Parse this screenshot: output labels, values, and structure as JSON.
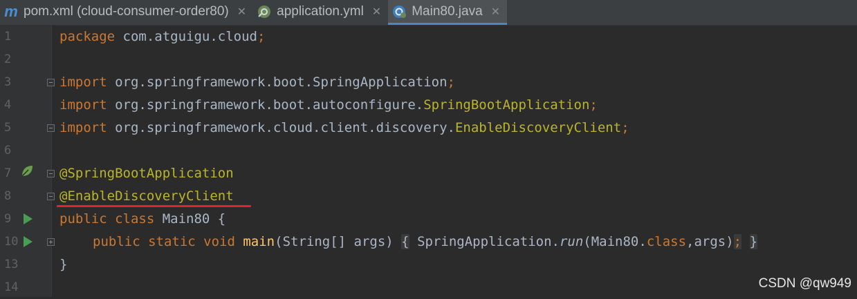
{
  "tabs": [
    {
      "label": "pom.xml (cloud-consumer-order80)",
      "icon": "maven-icon",
      "icon_glyph": "m"
    },
    {
      "label": "application.yml",
      "icon": "spring-config-icon"
    },
    {
      "label": "Main80.java",
      "icon": "java-class-icon",
      "active": true
    }
  ],
  "close_glyph": "✕",
  "line_numbers": [
    "1",
    "2",
    "3",
    "4",
    "5",
    "6",
    "7",
    "8",
    "9",
    "10",
    "13",
    "14"
  ],
  "code": {
    "l1_kw": "package",
    "l1_rest": " com.atguigu.cloud",
    "l3_kw": "import",
    "l3_rest": " org.springframework.boot.SpringApplication",
    "l4_kw": "import",
    "l4_rest": " org.springframework.boot.autoconfigure.",
    "l4_cls": "SpringBootApplication",
    "l5_kw": "import",
    "l5_rest": " org.springframework.cloud.client.discovery.",
    "l5_cls": "EnableDiscoveryClient",
    "l7_ann": "@SpringBootApplication",
    "l8_ann": "@EnableDiscoveryClient",
    "l9_kw": "public class",
    "l9_rest": " Main80 {",
    "l10_kw": "public static void",
    "l10_fn": "main",
    "l10_args": "(String[] args)",
    "l10_open": "{",
    "l10_body1": " SpringApplication.",
    "l10_run": "run",
    "l10_body2": "(Main80.",
    "l10_class": "class",
    "l10_body3": ",args)",
    "l10_semi": ";",
    "l10_close": "}",
    "l13": "}",
    "semicolon": ";"
  },
  "watermark": "CSDN @qw949",
  "colors": {
    "keyword": "#cc7832",
    "annotation": "#bbb529",
    "method": "#ffc66d",
    "text": "#a9b7c6",
    "highlight_underline": "#e0242b"
  }
}
